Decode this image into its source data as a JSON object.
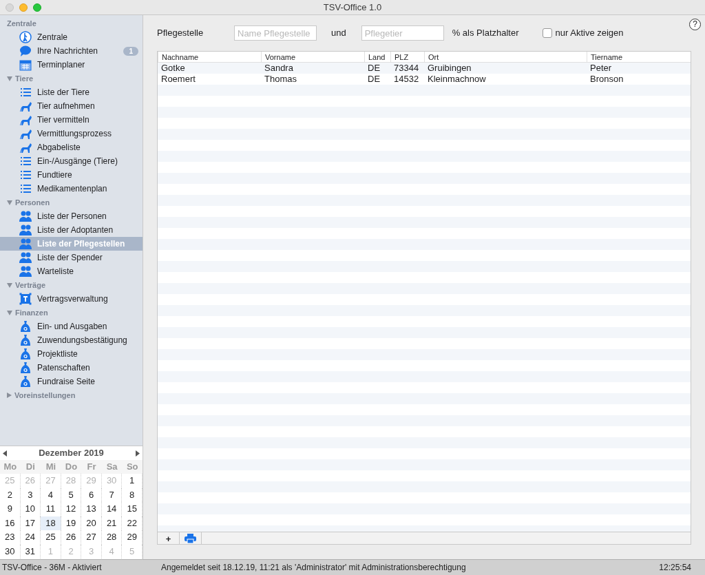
{
  "window": {
    "title": "TSV-Office 1.0"
  },
  "sidebar": {
    "groups": [
      {
        "label": "Zentrale",
        "items": [
          {
            "label": "Zentrale",
            "kind": "figure",
            "selected": false
          },
          {
            "label": "Ihre Nachrichten",
            "kind": "chat",
            "selected": false,
            "badge": "1"
          },
          {
            "label": "Terminplaner",
            "kind": "calendar",
            "selected": false
          }
        ]
      },
      {
        "label": "Tiere",
        "expanded": true,
        "items": [
          {
            "label": "Liste der Tiere",
            "kind": "list",
            "selected": false
          },
          {
            "label": "Tier aufnehmen",
            "kind": "dog",
            "selected": false
          },
          {
            "label": "Tier vermitteln",
            "kind": "dog",
            "selected": false
          },
          {
            "label": "Vermittlungsprozess",
            "kind": "dog",
            "selected": false
          },
          {
            "label": "Abgabeliste",
            "kind": "dog",
            "selected": false
          },
          {
            "label": "Ein-/Ausgänge (Tiere)",
            "kind": "list",
            "selected": false
          },
          {
            "label": "Fundtiere",
            "kind": "list",
            "selected": false
          },
          {
            "label": "Medikamentenplan",
            "kind": "list",
            "selected": false
          }
        ]
      },
      {
        "label": "Personen",
        "expanded": true,
        "items": [
          {
            "label": "Liste der Personen",
            "kind": "people",
            "selected": false
          },
          {
            "label": "Liste der Adoptanten",
            "kind": "people",
            "selected": false
          },
          {
            "label": "Liste der Pflegestellen",
            "kind": "people",
            "selected": true
          },
          {
            "label": "Liste der Spender",
            "kind": "people",
            "selected": false
          },
          {
            "label": "Warteliste",
            "kind": "people",
            "selected": false
          }
        ]
      },
      {
        "label": "Verträge",
        "expanded": true,
        "items": [
          {
            "label": "Vertragsverwaltung",
            "kind": "contract",
            "selected": false
          }
        ]
      },
      {
        "label": "Finanzen",
        "expanded": true,
        "items": [
          {
            "label": "Ein- und Ausgaben",
            "kind": "bag",
            "selected": false
          },
          {
            "label": "Zuwendungsbestätigung",
            "kind": "bag",
            "selected": false
          },
          {
            "label": "Projektliste",
            "kind": "bag",
            "selected": false
          },
          {
            "label": "Patenschaften",
            "kind": "bag",
            "selected": false
          },
          {
            "label": "Fundraise Seite",
            "kind": "bag",
            "selected": false
          }
        ]
      },
      {
        "label": "Voreinstellungen",
        "expanded": false
      }
    ]
  },
  "calendar": {
    "month": "Dezember 2019",
    "weekdays": [
      "Mo",
      "Di",
      "Mi",
      "Do",
      "Fr",
      "Sa",
      "So"
    ],
    "weeks": [
      [
        {
          "day": "25",
          "other_month": true,
          "selected": false
        },
        {
          "day": "26",
          "other_month": true,
          "selected": false
        },
        {
          "day": "27",
          "other_month": true,
          "selected": false
        },
        {
          "day": "28",
          "other_month": true,
          "selected": false
        },
        {
          "day": "29",
          "other_month": true,
          "selected": false
        },
        {
          "day": "30",
          "other_month": true,
          "selected": false
        },
        {
          "day": "1",
          "other_month": false,
          "selected": false
        }
      ],
      [
        {
          "day": "2",
          "other_month": false,
          "selected": false
        },
        {
          "day": "3",
          "other_month": false,
          "selected": false
        },
        {
          "day": "4",
          "other_month": false,
          "selected": false
        },
        {
          "day": "5",
          "other_month": false,
          "selected": false
        },
        {
          "day": "6",
          "other_month": false,
          "selected": false
        },
        {
          "day": "7",
          "other_month": false,
          "selected": false
        },
        {
          "day": "8",
          "other_month": false,
          "selected": false
        }
      ],
      [
        {
          "day": "9",
          "other_month": false,
          "selected": false
        },
        {
          "day": "10",
          "other_month": false,
          "selected": false
        },
        {
          "day": "11",
          "other_month": false,
          "selected": false
        },
        {
          "day": "12",
          "other_month": false,
          "selected": false
        },
        {
          "day": "13",
          "other_month": false,
          "selected": false
        },
        {
          "day": "14",
          "other_month": false,
          "selected": false
        },
        {
          "day": "15",
          "other_month": false,
          "selected": false
        }
      ],
      [
        {
          "day": "16",
          "other_month": false,
          "selected": false
        },
        {
          "day": "17",
          "other_month": false,
          "selected": false
        },
        {
          "day": "18",
          "other_month": false,
          "selected": true
        },
        {
          "day": "19",
          "other_month": false,
          "selected": false
        },
        {
          "day": "20",
          "other_month": false,
          "selected": false
        },
        {
          "day": "21",
          "other_month": false,
          "selected": false
        },
        {
          "day": "22",
          "other_month": false,
          "selected": false
        }
      ],
      [
        {
          "day": "23",
          "other_month": false,
          "selected": false
        },
        {
          "day": "24",
          "other_month": false,
          "selected": false
        },
        {
          "day": "25",
          "other_month": false,
          "selected": false
        },
        {
          "day": "26",
          "other_month": false,
          "selected": false
        },
        {
          "day": "27",
          "other_month": false,
          "selected": false
        },
        {
          "day": "28",
          "other_month": false,
          "selected": false
        },
        {
          "day": "29",
          "other_month": false,
          "selected": false
        }
      ],
      [
        {
          "day": "30",
          "other_month": false,
          "selected": false
        },
        {
          "day": "31",
          "other_month": false,
          "selected": false
        },
        {
          "day": "1",
          "other_month": true,
          "selected": false
        },
        {
          "day": "2",
          "other_month": true,
          "selected": false
        },
        {
          "day": "3",
          "other_month": true,
          "selected": false
        },
        {
          "day": "4",
          "other_month": true,
          "selected": false
        },
        {
          "day": "5",
          "other_month": true,
          "selected": false
        }
      ]
    ]
  },
  "help_button": "?",
  "filter": {
    "label": "Pflegestelle",
    "name_field": {
      "placeholder": "Name Pflegestelle"
    },
    "joiner": "und",
    "animal_field": {
      "placeholder": "Pflegetier"
    },
    "hint": "% als Platzhalter",
    "active_only": {
      "label": "nur Aktive zeigen",
      "checked": false
    }
  },
  "table": {
    "columns": [
      "Nachname",
      "Vorname",
      "Land",
      "PLZ",
      "Ort",
      "Tiername"
    ],
    "rows": [
      [
        "Gotke",
        "Sandra",
        "DE",
        "73344",
        "Gruibingen",
        "Peter"
      ],
      [
        "Roemert",
        "Thomas",
        "DE",
        "14532",
        "Kleinmachnow",
        "Bronson"
      ]
    ],
    "add_button": "+"
  },
  "status_bar": {
    "left": "TSV-Office - 36M - Aktiviert",
    "center": "Angemeldet seit 18.12.19, 11:21 als 'Administrator' mit Administrationsberechtigung",
    "right": "12:25:54"
  }
}
